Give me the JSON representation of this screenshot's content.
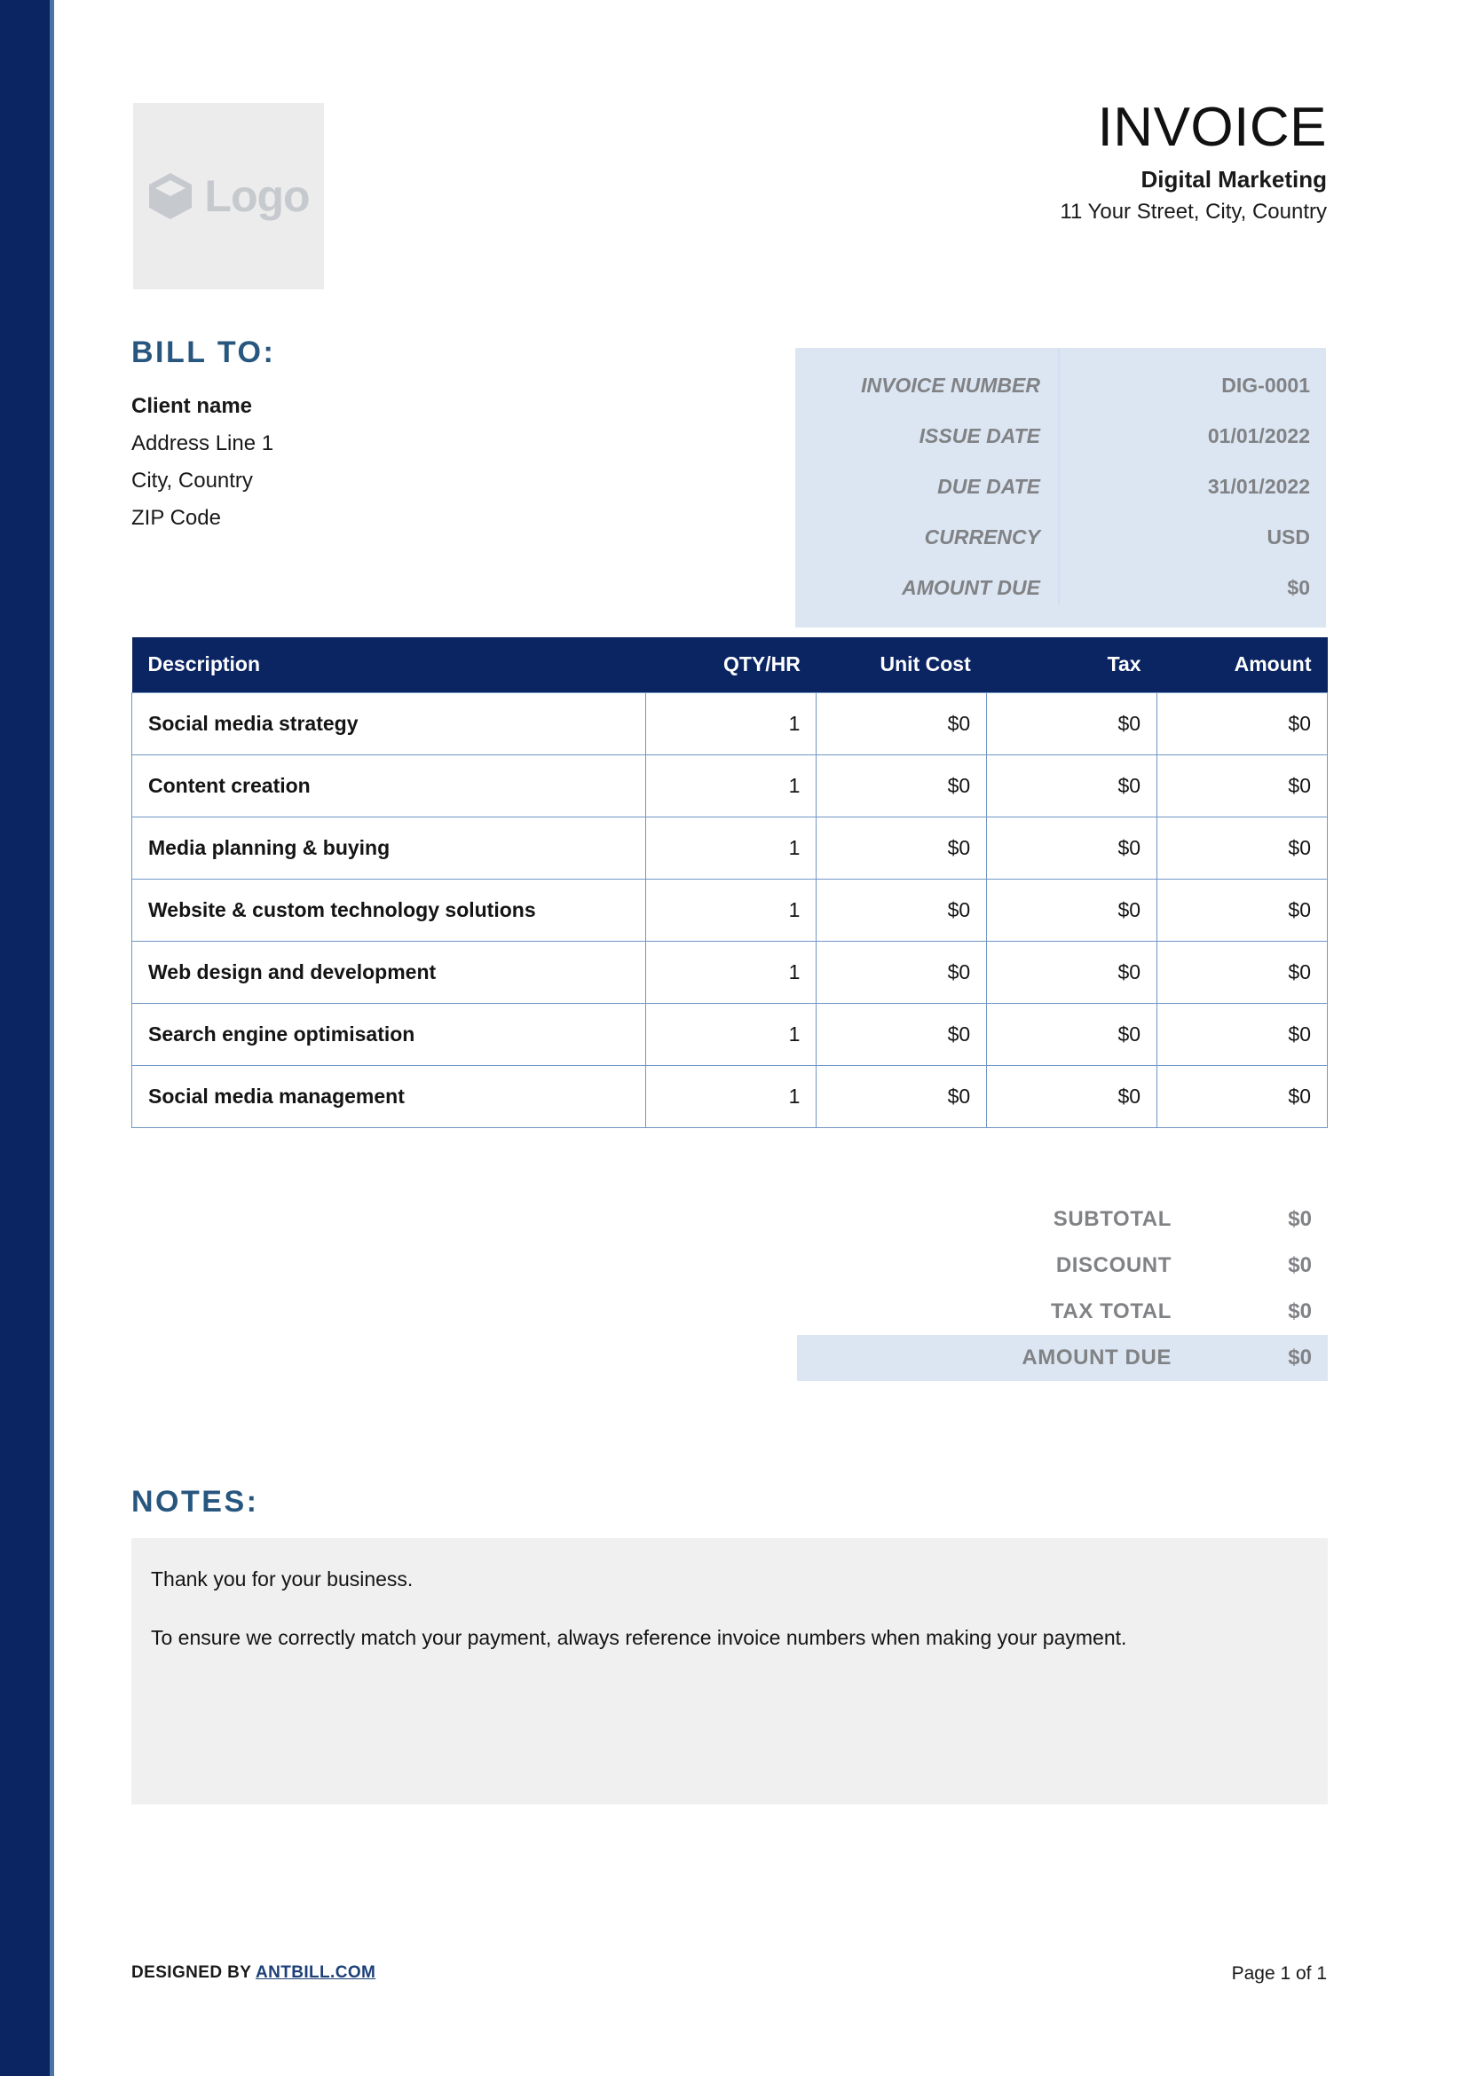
{
  "brand": {
    "navy": "#0b2462",
    "steel_blue": "#27567f",
    "light_blue": "#dce6f2",
    "border_blue": "#7296c4",
    "grey_text": "#808285",
    "notes_bg": "#f0f0f0"
  },
  "logo": {
    "icon": "cube-icon",
    "text": "Logo"
  },
  "header": {
    "title": "INVOICE",
    "company": "Digital Marketing",
    "address": "11 Your Street, City, Country"
  },
  "bill_to": {
    "heading": "BILL TO:",
    "client_name": "Client name",
    "address_line_1": "Address Line 1",
    "city_country": "City, Country",
    "zip_code": "ZIP Code"
  },
  "details": {
    "rows": [
      {
        "label": "INVOICE NUMBER",
        "value": "DIG-0001"
      },
      {
        "label": "ISSUE DATE",
        "value": "01/01/2022"
      },
      {
        "label": "DUE DATE",
        "value": "31/01/2022"
      },
      {
        "label": "CURRENCY",
        "value": "USD"
      },
      {
        "label": "AMOUNT DUE",
        "value": "$0"
      }
    ]
  },
  "items_table": {
    "columns": [
      "Description",
      "QTY/HR",
      "Unit Cost",
      "Tax",
      "Amount"
    ],
    "rows": [
      {
        "description": "Social media strategy",
        "qty": "1",
        "unit_cost": "$0",
        "tax": "$0",
        "amount": "$0"
      },
      {
        "description": "Content creation",
        "qty": "1",
        "unit_cost": "$0",
        "tax": "$0",
        "amount": "$0"
      },
      {
        "description": "Media planning & buying",
        "qty": "1",
        "unit_cost": "$0",
        "tax": "$0",
        "amount": "$0"
      },
      {
        "description": "Website & custom technology solutions",
        "qty": "1",
        "unit_cost": "$0",
        "tax": "$0",
        "amount": "$0"
      },
      {
        "description": "Web design and development",
        "qty": "1",
        "unit_cost": "$0",
        "tax": "$0",
        "amount": "$0"
      },
      {
        "description": "Search engine optimisation",
        "qty": "1",
        "unit_cost": "$0",
        "tax": "$0",
        "amount": "$0"
      },
      {
        "description": "Social media management",
        "qty": "1",
        "unit_cost": "$0",
        "tax": "$0",
        "amount": "$0"
      }
    ]
  },
  "totals": {
    "rows": [
      {
        "label": "SUBTOTAL",
        "value": "$0",
        "highlight": false
      },
      {
        "label": "DISCOUNT",
        "value": "$0",
        "highlight": false
      },
      {
        "label": "TAX TOTAL",
        "value": "$0",
        "highlight": false
      },
      {
        "label": "AMOUNT DUE",
        "value": "$0",
        "highlight": true
      }
    ]
  },
  "notes": {
    "heading": "NOTES:",
    "paragraph_1": "Thank you for your business.",
    "paragraph_2": "To ensure we correctly match your payment, always reference invoice numbers when making your payment."
  },
  "footer": {
    "designed_by_prefix": "DESIGNED BY ",
    "designed_by_link": "ANTBILL.COM",
    "page_label": "Page 1 of 1"
  }
}
